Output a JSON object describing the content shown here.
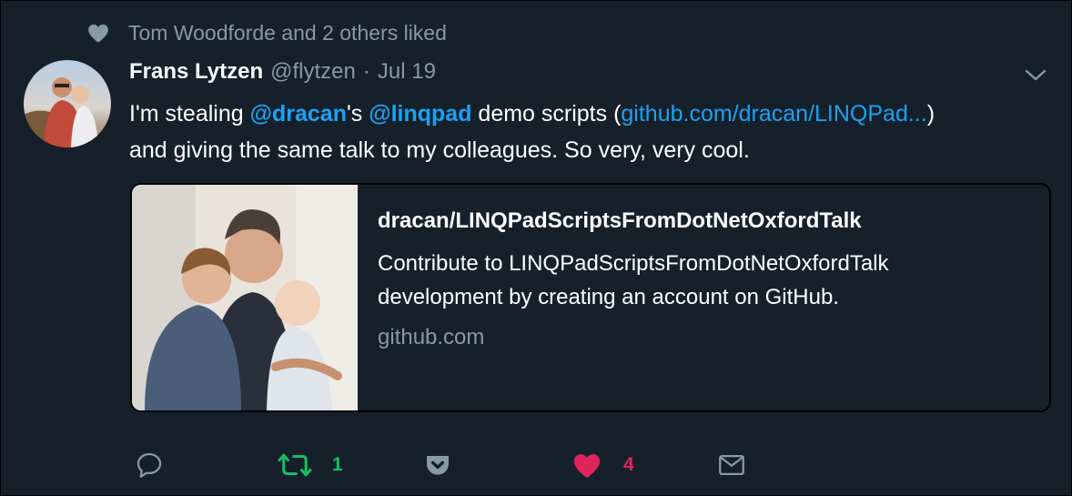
{
  "social_context": {
    "text": "Tom Woodforde and 2 others liked",
    "icon": "heart-icon"
  },
  "author": {
    "name": "Frans Lytzen",
    "handle": "@flytzen",
    "separator": "·",
    "date": "Jul 19"
  },
  "tweet": {
    "part1": "I'm stealing ",
    "mention1": "@dracan",
    "part2": "'s ",
    "mention2": "@linqpad",
    "part3": " demo scripts (",
    "link": "github.com/dracan/LINQPad...",
    "part4": ")",
    "line2": "and giving the same talk to my colleagues. So very, very cool."
  },
  "card": {
    "title": "dracan/LINQPadScriptsFromDotNetOxfordTalk",
    "description": "Contribute to LINQPadScriptsFromDotNetOxfordTalk development by creating an account on GitHub.",
    "domain": "github.com"
  },
  "actions": {
    "reply_icon": "reply-icon",
    "retweet_icon": "retweet-icon",
    "retweet_count": "1",
    "pocket_icon": "pocket-icon",
    "like_icon": "heart-filled-icon",
    "like_count": "4",
    "dm_icon": "envelope-icon"
  },
  "colors": {
    "background": "#15202b",
    "secondary_text": "#8899a6",
    "link": "#1da1f2",
    "retweet": "#17bf63",
    "like": "#e0245e"
  }
}
